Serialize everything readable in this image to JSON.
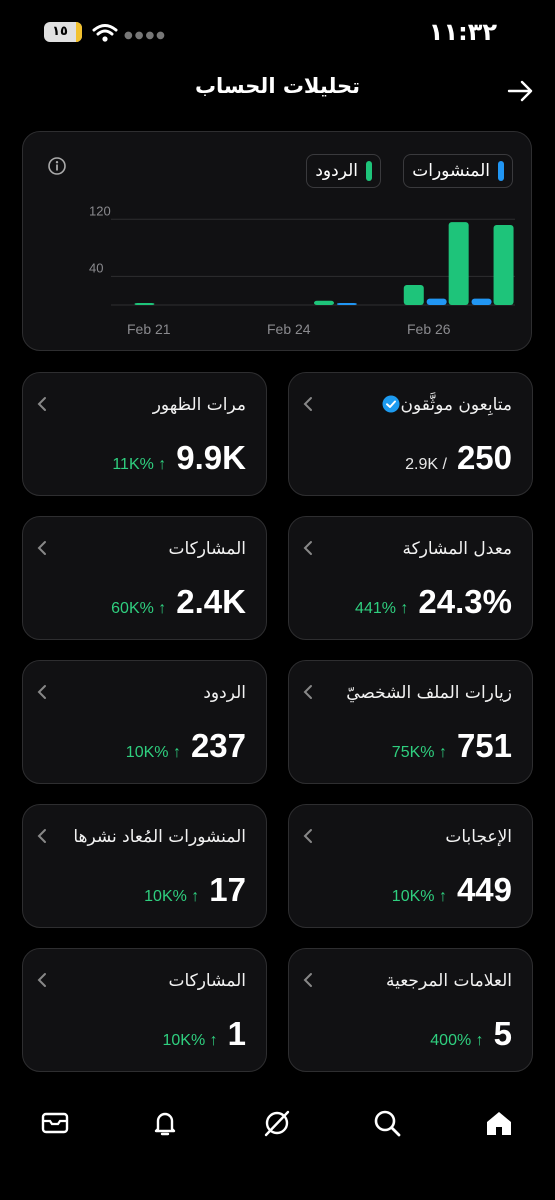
{
  "status_bar": {
    "time": "١١:٣٢",
    "battery_level": "١٥"
  },
  "header": {
    "title": "تحليلات الحساب"
  },
  "chart_legend": {
    "posts": "المنشورات",
    "replies": "الردود"
  },
  "colors": {
    "posts": "#2196f3",
    "replies": "#1ec47a",
    "positive_change": "#2fcf7f"
  },
  "chart_data": {
    "type": "bar",
    "x_tick_labels": [
      "Feb 21",
      "Feb 24",
      "Feb 26"
    ],
    "y_tick_labels": [
      "120",
      "40"
    ],
    "series": [
      {
        "name": "المنشورات",
        "values": [
          0,
          0,
          0,
          0,
          0,
          1,
          0,
          9,
          9
        ]
      },
      {
        "name": "الردود",
        "values": [
          2,
          0,
          0,
          0,
          6,
          0,
          28,
          116,
          112
        ]
      }
    ],
    "ylim": [
      0,
      140
    ],
    "grid": "horizontal"
  },
  "stats": {
    "verified_followers": {
      "label": "متابِعون موثَّقون",
      "value": "250",
      "total": "2.9K /"
    },
    "impressions": {
      "label": "مرات الظهور",
      "value": "9.9K",
      "change": "11K% ↑"
    },
    "engagement_rate": {
      "label": "معدل المشاركة",
      "value": "24.3%",
      "change": "441% ↑"
    },
    "engagements": {
      "label": "المشاركات",
      "value": "2.4K",
      "change": "60K% ↑"
    },
    "profile_visits": {
      "label": "زيارات الملف الشخصيّ",
      "value": "751",
      "change": "75K% ↑"
    },
    "replies": {
      "label": "الردود",
      "value": "237",
      "change": "10K% ↑"
    },
    "likes": {
      "label": "الإعجابات",
      "value": "449",
      "change": "10K% ↑"
    },
    "reposts": {
      "label": "المنشورات المُعاد نشرها",
      "value": "17",
      "change": "10K% ↑"
    },
    "bookmarks": {
      "label": "العلامات المرجعية",
      "value": "5",
      "change": "400% ↑"
    },
    "shares": {
      "label": "المشاركات",
      "value": "1",
      "change": "10K% ↑"
    }
  },
  "bottom_nav": [
    "home-icon",
    "search-icon",
    "grok-icon",
    "notifications-icon",
    "messages-icon"
  ]
}
